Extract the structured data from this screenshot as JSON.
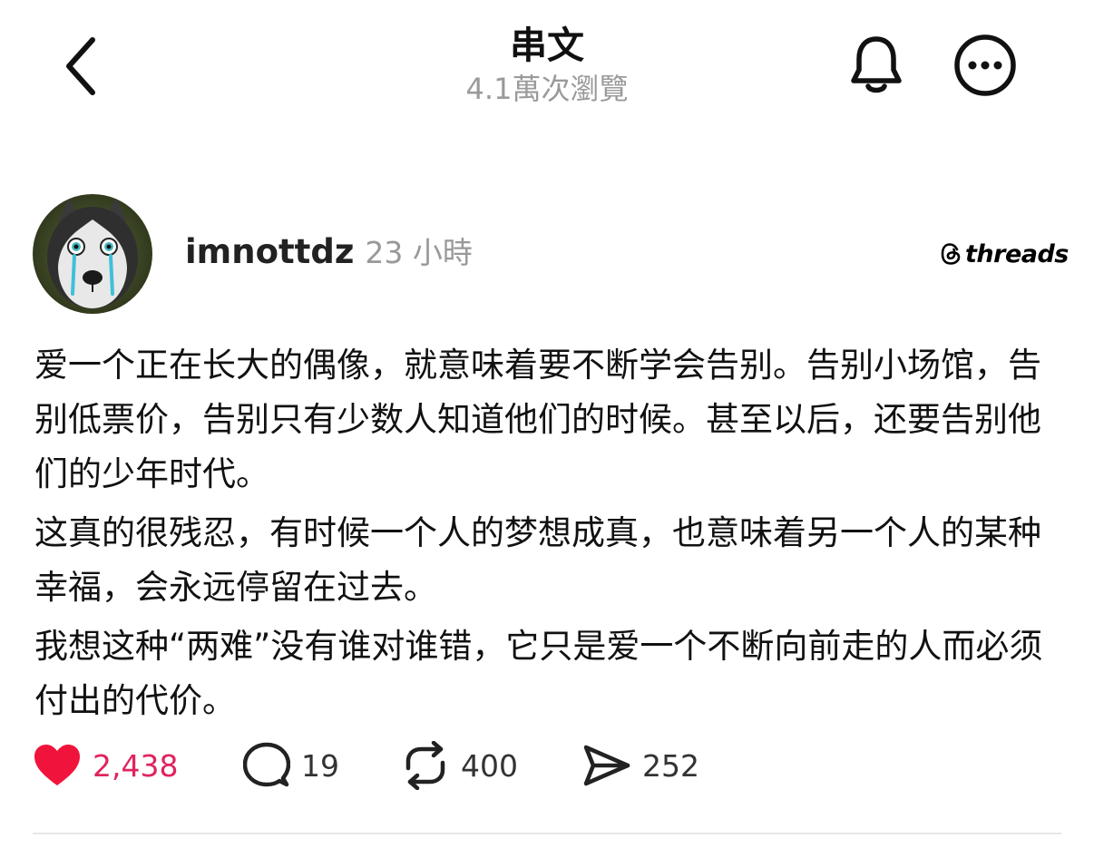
{
  "header": {
    "title": "串文",
    "views": "4.1萬次瀏覽",
    "back_icon": "chevron-left-icon",
    "bell_icon": "bell-icon",
    "more_icon": "more-horizontal-icon"
  },
  "post": {
    "author": {
      "username": "imnottdz",
      "time_ago": "23 小時",
      "avatar": "crying-husky-avatar"
    },
    "brand": {
      "logo_icon": "threads-logo-icon",
      "word": "threads"
    },
    "paragraphs": [
      "爱一个正在长大的偶像，就意味着要不断学会告别。告别小场馆，告别低票价，告别只有少数人知道他们的时候。甚至以后，还要告别他们的少年时代。",
      "这真的很残忍，有时候一个人的梦想成真，也意味着另一个人的某种幸福，会永远停留在过去。",
      "我想这种“两难”没有谁对谁错，它只是爱一个不断向前走的人而必须付出的代价。"
    ],
    "actions": {
      "likes": "2,438",
      "replies": "19",
      "reposts": "400",
      "shares": "252",
      "liked": true
    }
  },
  "colors": {
    "like_active": "#e0245e",
    "secondary_text": "#999999",
    "divider": "#e6e6e6"
  }
}
